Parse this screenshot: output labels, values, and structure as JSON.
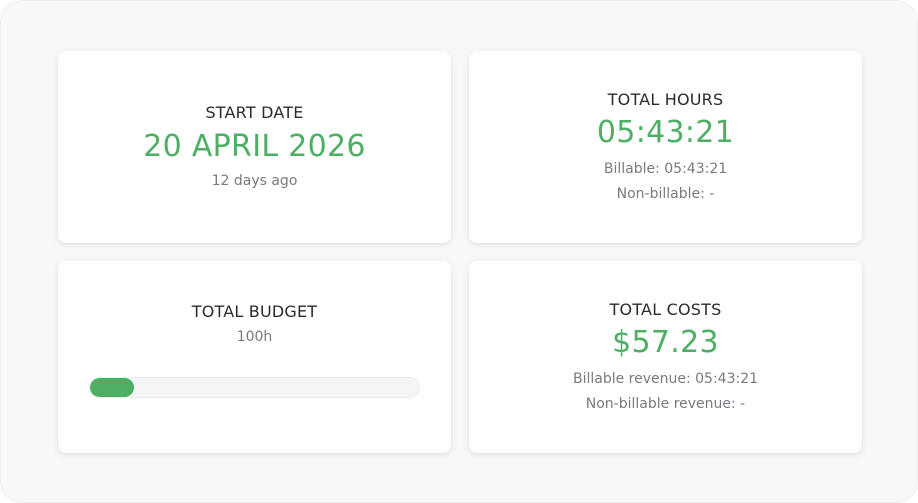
{
  "start_date": {
    "label": "START DATE",
    "value": "20 APRIL 2026",
    "relative": "12 days ago"
  },
  "total_hours": {
    "label": "TOTAL HOURS",
    "value": "05:43:21",
    "billable": "Billable: 05:43:21",
    "non_billable": "Non-billable: -"
  },
  "total_budget": {
    "label": "TOTAL BUDGET",
    "value": "100h",
    "progress_fraction": 0.135
  },
  "total_costs": {
    "label": "TOTAL COSTS",
    "value": "$57.23",
    "billable_revenue": "Billable revenue: 05:43:21",
    "non_billable_revenue": "Non-billable revenue: -"
  },
  "colors": {
    "accent": "#4caf64"
  }
}
